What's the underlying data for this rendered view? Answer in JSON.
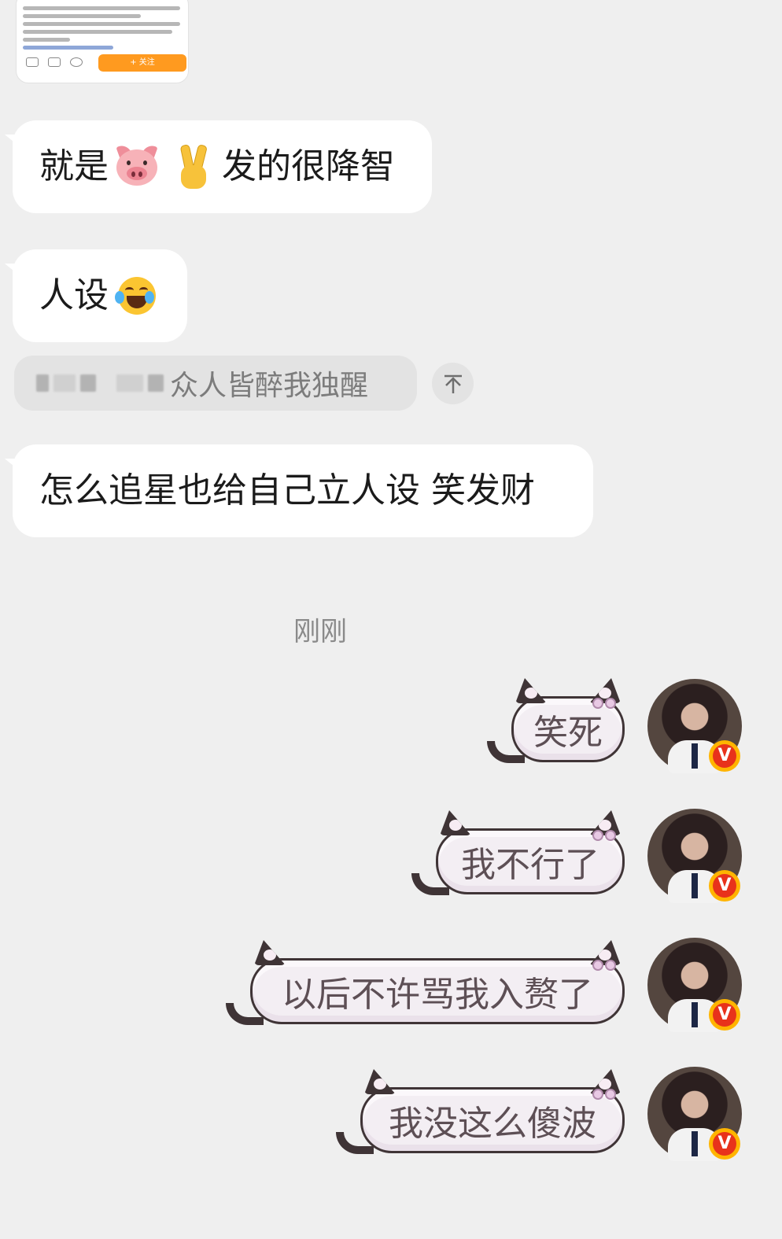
{
  "shared_card": {
    "note": "shared post preview (text too small to read)",
    "cta_label": "+ 关注"
  },
  "messages_incoming": [
    {
      "text_parts": [
        "就是",
        "发的很降智"
      ],
      "emojis": [
        "pig-face-icon",
        "victory-hand-icon"
      ]
    },
    {
      "text_parts": [
        "人设"
      ],
      "emojis": [
        "laughing-tears-icon"
      ]
    },
    {
      "text_parts": [
        "怎么追星也给自己立人设 笑发财"
      ],
      "emojis": []
    }
  ],
  "quoted": {
    "text": "众人皆醉我独醒",
    "pin_icon": "pin-to-top-icon"
  },
  "timestamp": "刚刚",
  "messages_outgoing": [
    {
      "text": "笑死"
    },
    {
      "text": "我不行了"
    },
    {
      "text": "以后不许骂我入赘了"
    },
    {
      "text": "我没这么傻波"
    }
  ],
  "avatar": {
    "badge": "V",
    "badge_color": "#e8321b",
    "badge_ring": "#ffb400"
  },
  "colors": {
    "background": "#efefef",
    "bubble_left": "#ffffff",
    "bubble_right": "#f3eef3",
    "accent": "#ff9a1f"
  }
}
